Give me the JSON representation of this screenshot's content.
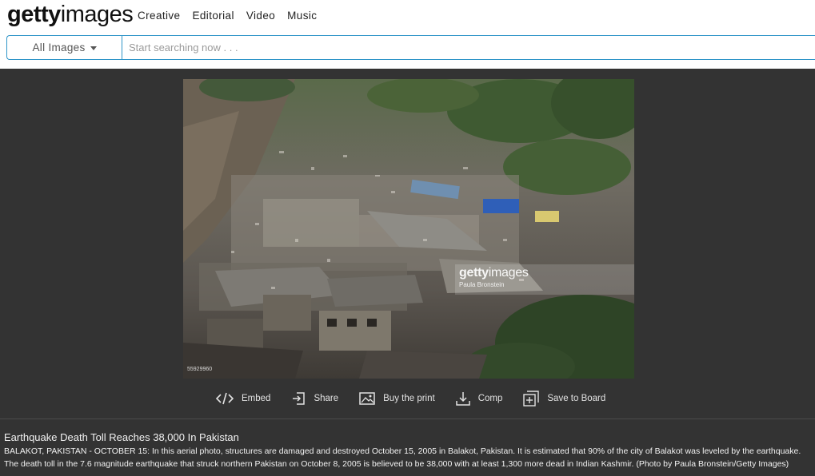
{
  "header": {
    "logo_bold": "getty",
    "logo_light": "images",
    "nav": [
      "Creative",
      "Editorial",
      "Video",
      "Music"
    ]
  },
  "search": {
    "filter_label": "All Images",
    "placeholder": "Start searching now . . .",
    "value": ""
  },
  "image": {
    "watermark_bold": "getty",
    "watermark_light": "images",
    "watermark_credit": "Paula Bronstein",
    "image_id": "55929960"
  },
  "actions": [
    {
      "label": "Embed",
      "icon": "code-icon"
    },
    {
      "label": "Share",
      "icon": "share-icon"
    },
    {
      "label": "Buy the print",
      "icon": "picture-icon"
    },
    {
      "label": "Comp",
      "icon": "download-icon"
    },
    {
      "label": "Save to Board",
      "icon": "add-board-icon"
    }
  ],
  "caption": {
    "title": "Earthquake Death Toll Reaches 38,000 In Pakistan",
    "body": "BALAKOT, PAKISTAN - OCTOBER 15: In this aerial photo, structures are damaged and destroyed October 15, 2005 in Balakot, Pakistan. It is estimated that 90% of the city of Balakot was leveled by the earthquake. The death toll in the 7.6 magnitude earthquake that struck northern Pakistan on October 8, 2005 is believed to be 38,000 with at least 1,300 more dead in Indian Kashmir. (Photo by Paula Bronstein/Getty Images)"
  },
  "colors": {
    "accent": "#2f95c8",
    "page_bg": "#333333",
    "header_bg": "#ffffff"
  }
}
